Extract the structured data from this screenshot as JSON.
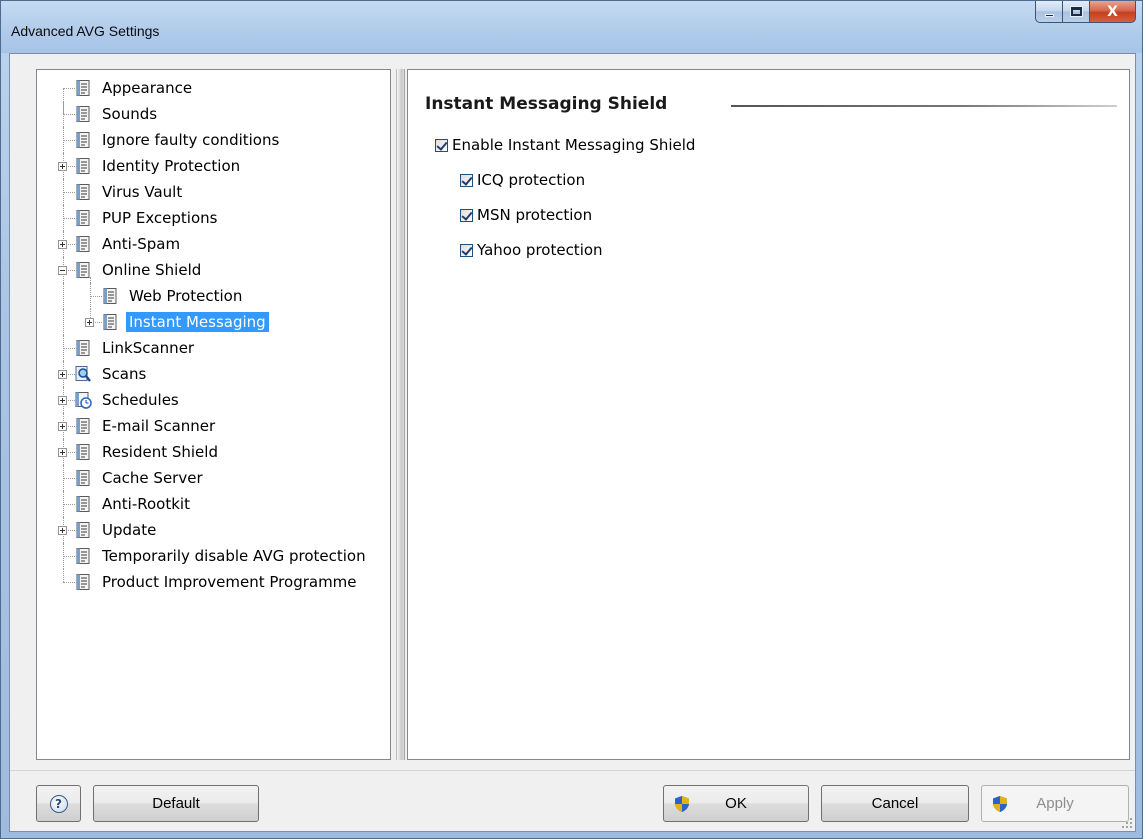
{
  "window": {
    "title": "Advanced AVG Settings",
    "controls": {
      "minimize": "",
      "maximize": "",
      "close": "X"
    }
  },
  "tree": {
    "items": [
      {
        "label": "Appearance",
        "level": 0,
        "expander": "none",
        "icon": "settings-page-icon"
      },
      {
        "label": "Sounds",
        "level": 0,
        "expander": "none",
        "icon": "settings-page-icon"
      },
      {
        "label": "Ignore faulty conditions",
        "level": 0,
        "expander": "none",
        "icon": "settings-page-icon"
      },
      {
        "label": "Identity Protection",
        "level": 0,
        "expander": "plus",
        "icon": "settings-page-icon"
      },
      {
        "label": "Virus Vault",
        "level": 0,
        "expander": "none",
        "icon": "settings-page-icon"
      },
      {
        "label": "PUP Exceptions",
        "level": 0,
        "expander": "none",
        "icon": "settings-page-icon"
      },
      {
        "label": "Anti-Spam",
        "level": 0,
        "expander": "plus",
        "icon": "settings-page-icon"
      },
      {
        "label": "Online Shield",
        "level": 0,
        "expander": "minus",
        "icon": "settings-page-icon"
      },
      {
        "label": "Web Protection",
        "level": 1,
        "expander": "none",
        "icon": "settings-page-icon"
      },
      {
        "label": "Instant Messaging",
        "level": 1,
        "expander": "plus",
        "icon": "settings-page-icon",
        "selected": true
      },
      {
        "label": "LinkScanner",
        "level": 0,
        "expander": "none",
        "icon": "settings-page-icon"
      },
      {
        "label": "Scans",
        "level": 0,
        "expander": "plus",
        "icon": "magnifier-icon"
      },
      {
        "label": "Schedules",
        "level": 0,
        "expander": "plus",
        "icon": "schedule-clock-icon"
      },
      {
        "label": "E-mail Scanner",
        "level": 0,
        "expander": "plus",
        "icon": "settings-page-icon"
      },
      {
        "label": "Resident Shield",
        "level": 0,
        "expander": "plus",
        "icon": "settings-page-icon"
      },
      {
        "label": "Cache Server",
        "level": 0,
        "expander": "none",
        "icon": "settings-page-icon"
      },
      {
        "label": "Anti-Rootkit",
        "level": 0,
        "expander": "none",
        "icon": "settings-page-icon"
      },
      {
        "label": "Update",
        "level": 0,
        "expander": "plus",
        "icon": "settings-page-icon"
      },
      {
        "label": "Temporarily disable AVG protection",
        "level": 0,
        "expander": "none",
        "icon": "settings-page-icon"
      },
      {
        "label": "Product Improvement Programme",
        "level": 0,
        "expander": "none",
        "icon": "settings-page-icon"
      }
    ]
  },
  "panel": {
    "title": "Instant Messaging Shield",
    "options": [
      {
        "label": "Enable Instant Messaging Shield",
        "checked": true,
        "indent": 0
      },
      {
        "label": "ICQ protection",
        "checked": true,
        "indent": 1
      },
      {
        "label": "MSN protection",
        "checked": true,
        "indent": 1
      },
      {
        "label": "Yahoo protection",
        "checked": true,
        "indent": 1
      }
    ]
  },
  "buttons": {
    "help": "?",
    "default": "Default",
    "ok": "OK",
    "cancel": "Cancel",
    "apply": "Apply"
  },
  "colors": {
    "selection": "#3399ff",
    "title_bar": "#b3cdeb",
    "dialog_background": "#f0f0f0"
  }
}
